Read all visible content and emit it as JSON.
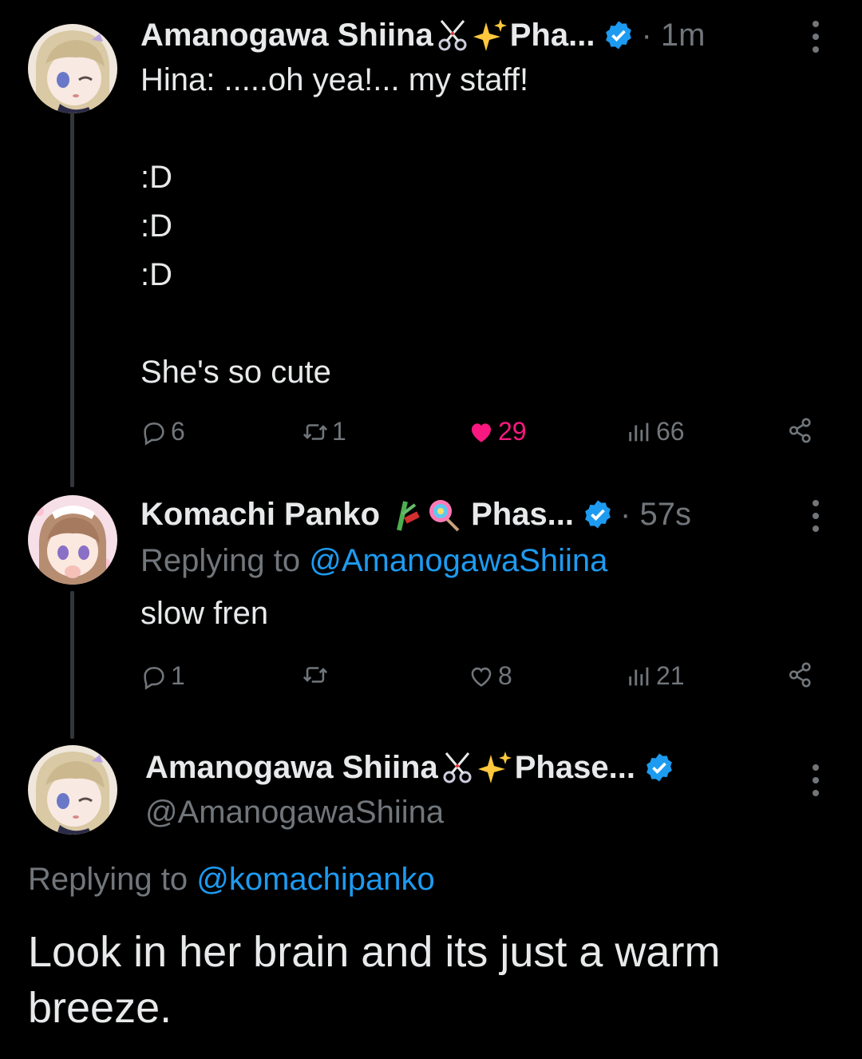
{
  "tweets": [
    {
      "display_name": "Amanogawa Shiina",
      "name_suffix": "Pha...",
      "time": "· 1m",
      "text": "Hina: .....oh yea!... my staff!\n\n:D\n:D\n:D\n\nShe's so cute",
      "replies": "6",
      "retweets": "1",
      "likes": "29",
      "views": "66"
    },
    {
      "display_name": "Komachi Panko",
      "name_suffix": "Phas...",
      "time": "· 57s",
      "replying_prefix": "Replying to",
      "replying_to": "@AmanogawaShiina",
      "text": "slow fren",
      "replies": "1",
      "retweets": "",
      "likes": "8",
      "views": "21"
    }
  ],
  "main_tweet": {
    "display_name": "Amanogawa Shiina",
    "name_suffix": "Phase...",
    "handle": "@AmanogawaShiina",
    "replying_prefix": "Replying to",
    "replying_to": "@komachipanko",
    "text": "Look in her brain and its just a warm breeze."
  },
  "colors": {
    "background": "#000000",
    "text": "#e7e9ea",
    "muted": "#71767b",
    "link": "#1d9bf0",
    "like": "#f91880",
    "verified": "#1d9bf0"
  },
  "icons": [
    "scissors-icon",
    "sparkles-icon",
    "bamboo-icon",
    "lollipop-icon",
    "verified-badge-icon",
    "more-icon",
    "reply-icon",
    "retweet-icon",
    "like-icon",
    "views-icon",
    "share-icon"
  ]
}
